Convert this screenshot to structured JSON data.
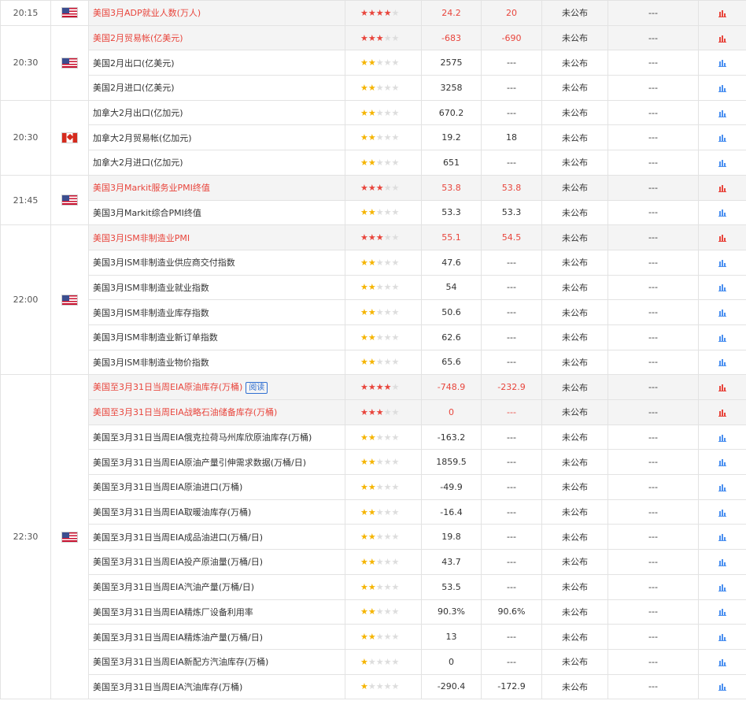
{
  "colors": {
    "highlight_text": "#e8453c",
    "star_on_high": "#e8453c",
    "star_on_normal": "#f5b400",
    "star_off": "#dddddd",
    "chart_blue": "#4a8ff0",
    "chart_red": "#e8453c",
    "tag_blue": "#2f6fd1"
  },
  "groups": [
    {
      "time": "20:15",
      "flag": "us",
      "flag_label": "us-flag-icon",
      "rows": [
        {
          "name": "美国3月ADP就业人数(万人)",
          "stars": 4,
          "prev": "24.2",
          "forecast": "20",
          "actual": "未公布",
          "extra": "---",
          "hl": true
        }
      ]
    },
    {
      "time": "20:30",
      "flag": "us",
      "flag_label": "us-flag-icon",
      "rows": [
        {
          "name": "美国2月贸易帐(亿美元)",
          "stars": 3,
          "prev": "-683",
          "forecast": "-690",
          "actual": "未公布",
          "extra": "---",
          "hl": true
        },
        {
          "name": "美国2月出口(亿美元)",
          "stars": 2,
          "prev": "2575",
          "forecast": "---",
          "actual": "未公布",
          "extra": "---",
          "hl": false
        },
        {
          "name": "美国2月进口(亿美元)",
          "stars": 2,
          "prev": "3258",
          "forecast": "---",
          "actual": "未公布",
          "extra": "---",
          "hl": false
        }
      ]
    },
    {
      "time": "20:30",
      "flag": "ca",
      "flag_label": "canada-flag-icon",
      "rows": [
        {
          "name": "加拿大2月出口(亿加元)",
          "stars": 2,
          "prev": "670.2",
          "forecast": "---",
          "actual": "未公布",
          "extra": "---",
          "hl": false
        },
        {
          "name": "加拿大2月贸易帐(亿加元)",
          "stars": 2,
          "prev": "19.2",
          "forecast": "18",
          "actual": "未公布",
          "extra": "---",
          "hl": false
        },
        {
          "name": "加拿大2月进口(亿加元)",
          "stars": 2,
          "prev": "651",
          "forecast": "---",
          "actual": "未公布",
          "extra": "---",
          "hl": false
        }
      ]
    },
    {
      "time": "21:45",
      "flag": "us",
      "flag_label": "us-flag-icon",
      "rows": [
        {
          "name": "美国3月Markit服务业PMI终值",
          "stars": 3,
          "prev": "53.8",
          "forecast": "53.8",
          "actual": "未公布",
          "extra": "---",
          "hl": true
        },
        {
          "name": "美国3月Markit综合PMI终值",
          "stars": 2,
          "prev": "53.3",
          "forecast": "53.3",
          "actual": "未公布",
          "extra": "---",
          "hl": false
        }
      ]
    },
    {
      "time": "22:00",
      "flag": "us",
      "flag_label": "us-flag-icon",
      "rows": [
        {
          "name": "美国3月ISM非制造业PMI",
          "stars": 3,
          "prev": "55.1",
          "forecast": "54.5",
          "actual": "未公布",
          "extra": "---",
          "hl": true
        },
        {
          "name": "美国3月ISM非制造业供应商交付指数",
          "stars": 2,
          "prev": "47.6",
          "forecast": "---",
          "actual": "未公布",
          "extra": "---",
          "hl": false
        },
        {
          "name": "美国3月ISM非制造业就业指数",
          "stars": 2,
          "prev": "54",
          "forecast": "---",
          "actual": "未公布",
          "extra": "---",
          "hl": false
        },
        {
          "name": "美国3月ISM非制造业库存指数",
          "stars": 2,
          "prev": "50.6",
          "forecast": "---",
          "actual": "未公布",
          "extra": "---",
          "hl": false
        },
        {
          "name": "美国3月ISM非制造业新订单指数",
          "stars": 2,
          "prev": "62.6",
          "forecast": "---",
          "actual": "未公布",
          "extra": "---",
          "hl": false
        },
        {
          "name": "美国3月ISM非制造业物价指数",
          "stars": 2,
          "prev": "65.6",
          "forecast": "---",
          "actual": "未公布",
          "extra": "---",
          "hl": false
        }
      ]
    },
    {
      "time": "22:30",
      "flag": "us",
      "flag_label": "us-flag-icon",
      "rows": [
        {
          "name": "美国至3月31日当周EIA原油库存(万桶)",
          "tag": "阅读",
          "stars": 4,
          "prev": "-748.9",
          "forecast": "-232.9",
          "actual": "未公布",
          "extra": "---",
          "hl": true
        },
        {
          "name": "美国至3月31日当周EIA战略石油储备库存(万桶)",
          "stars": 3,
          "prev": "0",
          "forecast": "---",
          "actual": "未公布",
          "extra": "---",
          "hl": true
        },
        {
          "name": "美国至3月31日当周EIA俄克拉荷马州库欣原油库存(万桶)",
          "stars": 2,
          "prev": "-163.2",
          "forecast": "---",
          "actual": "未公布",
          "extra": "---",
          "hl": false
        },
        {
          "name": "美国至3月31日当周EIA原油产量引伸需求数据(万桶/日)",
          "stars": 2,
          "prev": "1859.5",
          "forecast": "---",
          "actual": "未公布",
          "extra": "---",
          "hl": false
        },
        {
          "name": "美国至3月31日当周EIA原油进口(万桶)",
          "stars": 2,
          "prev": "-49.9",
          "forecast": "---",
          "actual": "未公布",
          "extra": "---",
          "hl": false
        },
        {
          "name": "美国至3月31日当周EIA取暖油库存(万桶)",
          "stars": 2,
          "prev": "-16.4",
          "forecast": "---",
          "actual": "未公布",
          "extra": "---",
          "hl": false
        },
        {
          "name": "美国至3月31日当周EIA成品油进口(万桶/日)",
          "stars": 2,
          "prev": "19.8",
          "forecast": "---",
          "actual": "未公布",
          "extra": "---",
          "hl": false
        },
        {
          "name": "美国至3月31日当周EIA投产原油量(万桶/日)",
          "stars": 2,
          "prev": "43.7",
          "forecast": "---",
          "actual": "未公布",
          "extra": "---",
          "hl": false
        },
        {
          "name": "美国至3月31日当周EIA汽油产量(万桶/日)",
          "stars": 2,
          "prev": "53.5",
          "forecast": "---",
          "actual": "未公布",
          "extra": "---",
          "hl": false
        },
        {
          "name": "美国至3月31日当周EIA精炼厂设备利用率",
          "stars": 2,
          "prev": "90.3%",
          "forecast": "90.6%",
          "actual": "未公布",
          "extra": "---",
          "hl": false
        },
        {
          "name": "美国至3月31日当周EIA精炼油产量(万桶/日)",
          "stars": 2,
          "prev": "13",
          "forecast": "---",
          "actual": "未公布",
          "extra": "---",
          "hl": false
        },
        {
          "name": "美国至3月31日当周EIA新配方汽油库存(万桶)",
          "stars": 1,
          "prev": "0",
          "forecast": "---",
          "actual": "未公布",
          "extra": "---",
          "hl": false
        },
        {
          "name": "美国至3月31日当周EIA汽油库存(万桶)",
          "stars": 1,
          "prev": "-290.4",
          "forecast": "-172.9",
          "actual": "未公布",
          "extra": "---",
          "hl": false
        }
      ]
    }
  ]
}
